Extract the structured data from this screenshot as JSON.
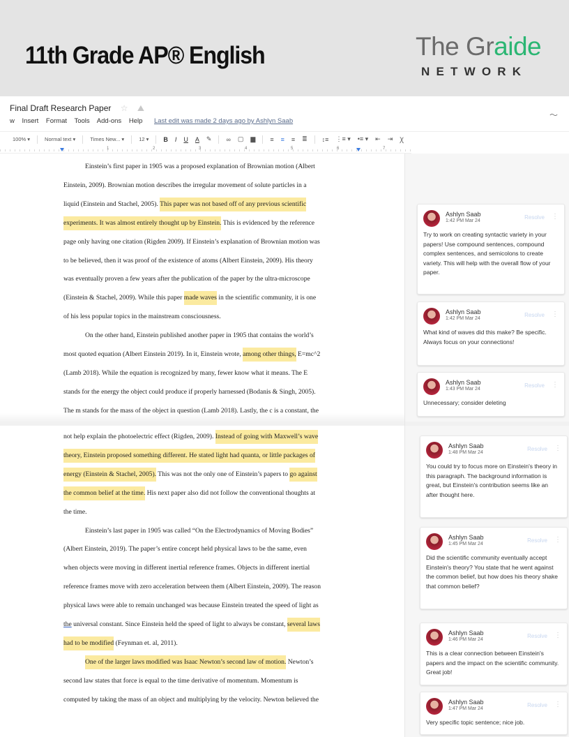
{
  "banner": {
    "title": "11th Grade AP® English",
    "brand_prefix": "The Gr",
    "brand_accent": "aide",
    "brand_sub": "NETWORK"
  },
  "doc": {
    "title": "Final Draft Research Paper",
    "menu": [
      "w",
      "Insert",
      "Format",
      "Tools",
      "Add-ons",
      "Help"
    ],
    "last_edit": "Last edit was made 2 days ago by Ashlyn Saab"
  },
  "toolbar": {
    "zoom": "100%",
    "style": "Normal text",
    "font": "Times New...",
    "size": "12",
    "bold": "B",
    "italic": "I",
    "underline": "U",
    "text_color": "A"
  },
  "ruler_numbers": [
    "1",
    "2",
    "3",
    "4",
    "5",
    "6",
    "7"
  ],
  "page1_lines": [
    {
      "indent": true,
      "segments": [
        {
          "t": "Einstein’s first paper in 1905 was a proposed explanation of Brownian motion (Albert",
          "h": false
        }
      ]
    },
    {
      "indent": false,
      "segments": [
        {
          "t": "Einstein, 2009).  Brownian motion describes the irregular movement of solute particles in a",
          "h": false
        }
      ]
    },
    {
      "indent": false,
      "segments": [
        {
          "t": "liquid (Einstein and Stachel, 2005).  ",
          "h": false
        },
        {
          "t": "This paper was not based off of any previous scientific",
          "h": true
        }
      ]
    },
    {
      "indent": false,
      "segments": [
        {
          "t": "experiments.  It was almost entirely thought up by Einstein.",
          "h": true
        },
        {
          "t": "  This is evidenced by the reference",
          "h": false
        }
      ]
    },
    {
      "indent": false,
      "segments": [
        {
          "t": "page only having one citation (Rigden 2009).  If Einstein’s explanation of Brownian motion was",
          "h": false
        }
      ]
    },
    {
      "indent": false,
      "segments": [
        {
          "t": "to be believed, then it was proof of the existence of atoms (Albert Einstein, 2009).  His theory",
          "h": false
        }
      ]
    },
    {
      "indent": false,
      "segments": [
        {
          "t": "was eventually proven a few years after the publication of the paper by the ultra-microscope",
          "h": false
        }
      ]
    },
    {
      "indent": false,
      "segments": [
        {
          "t": "(Einstein & Stachel, 2009).  While this paper ",
          "h": false
        },
        {
          "t": "made waves",
          "h": true
        },
        {
          "t": " in the scientific community, it is one",
          "h": false
        }
      ]
    },
    {
      "indent": false,
      "segments": [
        {
          "t": "of his less popular topics in the mainstream consciousness.",
          "h": false
        }
      ]
    },
    {
      "indent": true,
      "segments": [
        {
          "t": "On the other hand, Einstein published another paper in 1905 that contains the world’s",
          "h": false
        }
      ]
    },
    {
      "indent": false,
      "segments": [
        {
          "t": "most quoted equation (Albert Einstein 2019).  In it, Einstein wrote, ",
          "h": false
        },
        {
          "t": "among other things,",
          "h": true
        },
        {
          "t": " E=mc^2",
          "h": false
        }
      ]
    },
    {
      "indent": false,
      "segments": [
        {
          "t": "(Lamb 2018).  While the equation is recognized by many, fewer know what it means.  The E",
          "h": false
        }
      ]
    },
    {
      "indent": false,
      "segments": [
        {
          "t": "stands for the energy the object could produce if properly harnessed (Bodanis & Singh, 2005).",
          "h": false
        }
      ]
    },
    {
      "indent": false,
      "segments": [
        {
          "t": "The m stands for the mass of the object in question (Lamb 2018).  Lastly, the c is a constant, the",
          "h": false
        }
      ]
    }
  ],
  "page2_lines": [
    {
      "indent": false,
      "segments": [
        {
          "t": "not help explain the photoelectric effect (Rigden, 2009).  ",
          "h": false
        },
        {
          "t": "Instead of going with Maxwell’s wave",
          "h": true
        }
      ]
    },
    {
      "indent": false,
      "segments": [
        {
          "t": "theory, Einstein proposed something different.    He stated light had quanta, or little packages of",
          "h": true
        }
      ]
    },
    {
      "indent": false,
      "segments": [
        {
          "t": "energy (Einstein & Stachel, 2005).",
          "h": true
        },
        {
          "t": "  This was not the only one of Einstein’s papers to ",
          "h": false
        },
        {
          "t": "go against",
          "h": true
        }
      ]
    },
    {
      "indent": false,
      "segments": [
        {
          "t": "the common belief at the time.",
          "h": true
        },
        {
          "t": "  His next paper also did not follow the conventional thoughts at",
          "h": false
        }
      ]
    },
    {
      "indent": false,
      "segments": [
        {
          "t": "the time.",
          "h": false
        }
      ]
    },
    {
      "indent": true,
      "segments": [
        {
          "t": "Einstein’s last paper in 1905 was called “On the Electrodynamics of Moving Bodies”",
          "h": false
        }
      ]
    },
    {
      "indent": false,
      "segments": [
        {
          "t": "(Albert Einstein, 2019).  The paper’s entire concept held physical laws to be the same, even",
          "h": false
        }
      ]
    },
    {
      "indent": false,
      "segments": [
        {
          "t": "when objects were moving in different inertial reference frames.  Objects in different inertial",
          "h": false
        }
      ]
    },
    {
      "indent": false,
      "segments": [
        {
          "t": "reference frames move with zero acceleration between them (Albert Einstein, 2009).  The reason",
          "h": false
        }
      ]
    },
    {
      "indent": false,
      "segments": [
        {
          "t": "physical laws were able to remain unchanged was because Einstein treated the speed of light as",
          "h": false
        }
      ]
    },
    {
      "indent": false,
      "segments": [
        {
          "t": "the",
          "h": false,
          "u": true
        },
        {
          "t": " universal constant.  Since Einstein held the speed of light to always be constant, ",
          "h": false
        },
        {
          "t": "several laws",
          "h": true
        }
      ]
    },
    {
      "indent": false,
      "segments": [
        {
          "t": "had to be modified",
          "h": true
        },
        {
          "t": " (Feynman et. al, 2011).",
          "h": false
        }
      ]
    },
    {
      "indent": true,
      "segments": [
        {
          "t": "One of the larger laws modified was Isaac Newton’s second law of motion.",
          "h": true
        },
        {
          "t": "  Newton’s",
          "h": false
        }
      ]
    },
    {
      "indent": false,
      "segments": [
        {
          "t": "second law states that force is equal to the time derivative of momentum.  Momentum is",
          "h": false
        }
      ]
    },
    {
      "indent": false,
      "segments": [
        {
          "t": "computed by taking the mass of an object and multiplying by the velocity.  Newton believed the",
          "h": false
        }
      ]
    }
  ],
  "comments": [
    {
      "author": "Ashlyn Saab",
      "time": "1:42 PM Mar 24",
      "resolve": "Resolve",
      "text": "Try to work on creating syntactic variety in your papers! Use compound sentences, compound complex sentences, and semicolons to create variety. This will help with the overall flow of your paper."
    },
    {
      "author": "Ashlyn Saab",
      "time": "1:42 PM Mar 24",
      "resolve": "Resolve",
      "text": "What kind of waves did this make? Be specific. Always focus on your connections!"
    },
    {
      "author": "Ashlyn Saab",
      "time": "1:43 PM Mar 24",
      "resolve": "Resolve",
      "text": "Unnecessary; consider deleting"
    },
    {
      "author": "Ashlyn Saab",
      "time": "1:48 PM Mar 24",
      "resolve": "Resolve",
      "text": "You could try to focus more on Einstein's theory in this paragraph. The background information is great, but Einstein's contribution seems like an after thought here."
    },
    {
      "author": "Ashlyn Saab",
      "time": "1:45 PM Mar 24",
      "resolve": "Resolve",
      "text": "Did the scientific community eventually accept Einstein's theory? You state that he went against the common belief, but how does his theory shake that common belief?"
    },
    {
      "author": "Ashlyn Saab",
      "time": "1:46 PM Mar 24",
      "resolve": "Resolve",
      "text": "This is a clear connection between Einstein's papers and the impact on the scientific community. Great job!"
    },
    {
      "author": "Ashlyn Saab",
      "time": "1:47 PM Mar 24",
      "resolve": "Resolve",
      "text": "Very specific topic sentence; nice job."
    }
  ],
  "colors": {
    "highlight": "#fbeaa0",
    "brand_green": "#2bb673",
    "banner_bg": "#e4e4e4"
  }
}
